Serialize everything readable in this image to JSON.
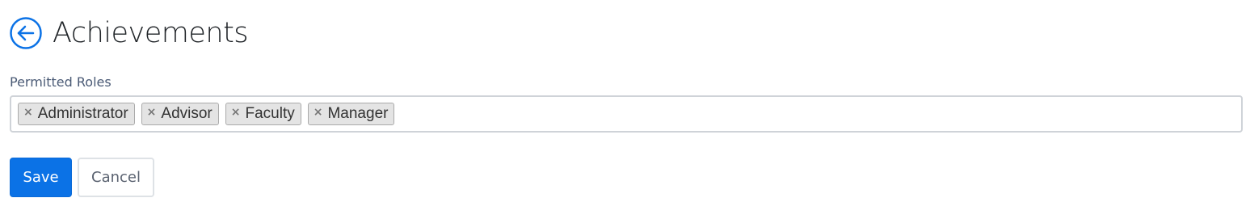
{
  "header": {
    "back_icon": "arrow-left-circle-icon",
    "title": "Achievements",
    "accent_color": "#0b72e6"
  },
  "permitted_roles": {
    "label": "Permitted Roles",
    "remove_glyph": "×",
    "tags": [
      {
        "label": "Administrator"
      },
      {
        "label": "Advisor"
      },
      {
        "label": "Faculty"
      },
      {
        "label": "Manager"
      }
    ]
  },
  "actions": {
    "save_label": "Save",
    "cancel_label": "Cancel"
  }
}
